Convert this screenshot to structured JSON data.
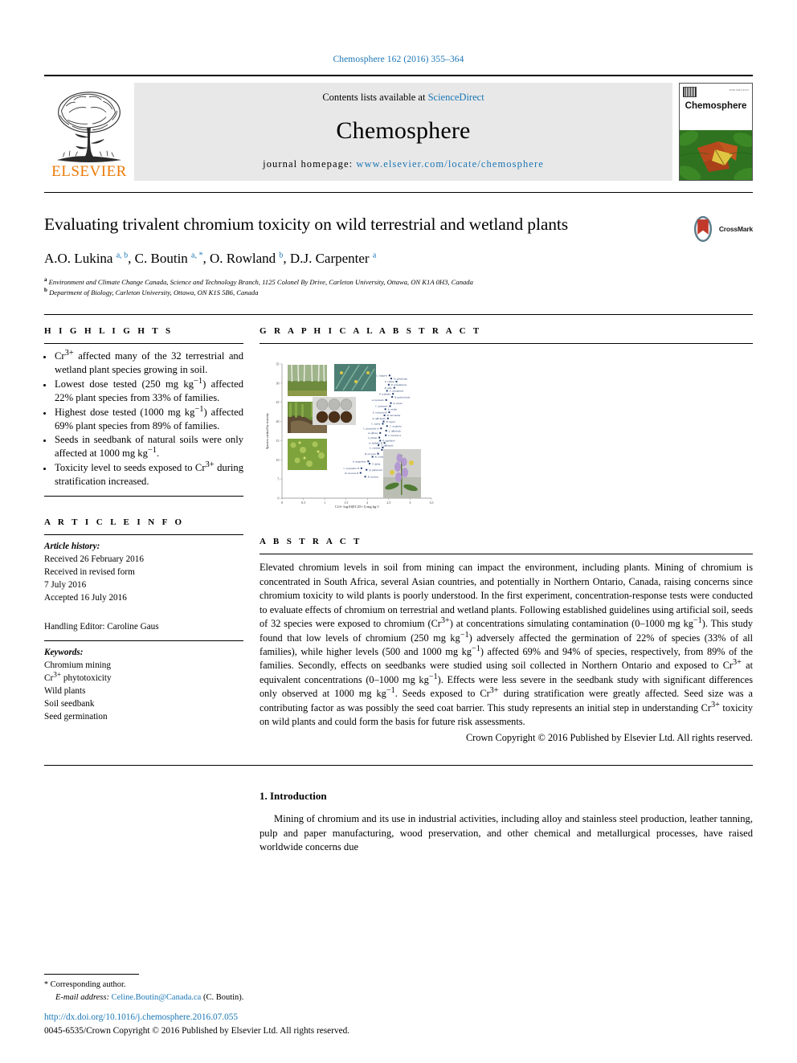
{
  "running_head": "Chemosphere 162 (2016) 355–364",
  "masthead": {
    "contents_prefix": "Contents lists available at ",
    "sciencedirect": "ScienceDirect",
    "journal_name": "Chemosphere",
    "homepage_prefix": "journal homepage: ",
    "homepage_url": "www.elsevier.com/locate/chemosphere",
    "publisher_logo_text": "ELSEVIER",
    "cover_title": "Chemosphere",
    "accent_blue": "#1a76b5",
    "elsevier_orange": "#ec7a08"
  },
  "article": {
    "title": "Evaluating trivalent chromium toxicity on wild terrestrial and wetland plants",
    "authors_html": "A.O. Lukina <sup>a, b</sup>, C. Boutin <sup>a, *</sup>, O. Rowland <sup>b</sup>, D.J. Carpenter <sup>a</sup>",
    "affiliation_a": "Environment and Climate Change Canada, Science and Technology Branch, 1125 Colonel By Drive, Carleton University, Ottawa, ON K1A 0H3, Canada",
    "affiliation_b": "Department of Biology, Carleton University, Ottawa, ON K1S 5B6, Canada",
    "crossmark_label": "CrossMark"
  },
  "highlights": {
    "heading": "H I G H L I G H T S",
    "items": [
      "Cr<sup>3+</sup> affected many of the 32 terrestrial and wetland plant species growing in soil.",
      "Lowest dose tested (250 mg kg<sup>−1</sup>) affected 22% plant species from 33% of families.",
      "Highest dose tested (1000 mg kg<sup>−1</sup>) affected 69% plant species from 89% of families.",
      "Seeds in seedbank of natural soils were only affected at 1000 mg kg<sup>−1</sup>.",
      "Toxicity level to seeds exposed to Cr<sup>3+</sup> during stratification increased."
    ]
  },
  "article_info": {
    "heading": "A R T I C L E   I N F O",
    "history_label": "Article history:",
    "received": "Received 26 February 2016",
    "revised_label": "Received in revised form",
    "revised_date": "7 July 2016",
    "accepted": "Accepted 16 July 2016",
    "handling_editor": "Handling Editor: Caroline Gaus",
    "keywords_label": "Keywords:",
    "keywords": [
      "Chromium mining",
      "Cr<sup>3+</sup> phytotoxicity",
      "Wild plants",
      "Soil seedbank",
      "Seed germination"
    ]
  },
  "graphical_abstract": {
    "heading": "G R A P H I C A L   A B S T R A C T"
  },
  "abstract": {
    "heading": "A B S T R A C T",
    "body": "Elevated chromium levels in soil from mining can impact the environment, including plants. Mining of chromium is concentrated in South Africa, several Asian countries, and potentially in Northern Ontario, Canada, raising concerns since chromium toxicity to wild plants is poorly understood. In the first experiment, concentration-response tests were conducted to evaluate effects of chromium on terrestrial and wetland plants. Following established guidelines using artificial soil, seeds of 32 species were exposed to chromium (Cr<sup>3+</sup>) at concentrations simulating contamination (0–1000 mg kg<sup>−1</sup>). This study found that low levels of chromium (250 mg kg<sup>−1</sup>) adversely affected the germination of 22% of species (33% of all families), while higher levels (500 and 1000 mg kg<sup>−1</sup>) affected 69% and 94% of species, respectively, from 89% of the families. Secondly, effects on seedbanks were studied using soil collected in Northern Ontario and exposed to Cr<sup>3+</sup> at equivalent concentrations (0–1000 mg kg<sup>−1</sup>). Effects were less severe in the seedbank study with significant differences only observed at 1000 mg kg<sup>−1</sup>. Seeds exposed to Cr<sup>3+</sup> during stratification were greatly affected. Seed size was a contributing factor as was possibly the seed coat barrier. This study represents an initial step in understanding Cr<sup>3+</sup> toxicity on wild plants and could form the basis for future risk assessments.",
    "copyright": "Crown Copyright © 2016 Published by Elsevier Ltd. All rights reserved."
  },
  "introduction": {
    "heading": "1. Introduction",
    "paragraph": "Mining of chromium and its use in industrial activities, including alloy and stainless steel production, leather tanning, pulp and paper manufacturing, wood preservation, and other chemical and metallurgical processes, have raised worldwide concerns due"
  },
  "footnote": {
    "star": "*",
    "corresponding": "Corresponding author.",
    "email_label": "E-mail address:",
    "email": "Celine.Boutin@Canada.ca",
    "email_owner": "(C. Boutin)."
  },
  "imprint": {
    "doi": "http://dx.doi.org/10.1016/j.chemosphere.2016.07.055",
    "issn_line": "0045-6535/Crown Copyright © 2016 Published by Elsevier Ltd. All rights reserved."
  },
  "chart_data": {
    "type": "scatter",
    "title": "",
    "xlabel": "Cr3+ log10(EC25+1) mg kg-1",
    "ylabel": "Species ranked by toxicity",
    "xlim": [
      0,
      3.5
    ],
    "ylim": [
      0,
      35
    ],
    "xticks": [
      "0",
      "0.5",
      "1",
      "1.5",
      "2",
      "2.5",
      "3",
      "3.5"
    ],
    "yticks": [
      "0",
      "5",
      "10",
      "15",
      "20",
      "25",
      "30",
      "35"
    ],
    "grid": false,
    "legend": "none",
    "points": [
      {
        "label": "L. vulgaris",
        "x": 2.52,
        "y": 32.0
      },
      {
        "label": "D. glomerata",
        "x": 2.56,
        "y": 31.2
      },
      {
        "label": "E. ciliata",
        "x": 2.68,
        "y": 30.4
      },
      {
        "label": "P. arundinacea",
        "x": 2.5,
        "y": 29.6
      },
      {
        "label": "B. alba",
        "x": 2.63,
        "y": 28.8
      },
      {
        "label": "E. canadensis",
        "x": 2.46,
        "y": 28.0
      },
      {
        "label": "P. sedoides",
        "x": 2.6,
        "y": 27.2
      },
      {
        "label": "B. galericulata",
        "x": 2.58,
        "y": 26.4
      },
      {
        "label": "A. hyemalis",
        "x": 2.44,
        "y": 25.6
      },
      {
        "label": "A. tenuis",
        "x": 2.55,
        "y": 24.8
      },
      {
        "label": "C. pratensis",
        "x": 2.53,
        "y": 24.0
      },
      {
        "label": "A. viridis",
        "x": 2.42,
        "y": 23.2
      },
      {
        "label": "E. urticaria B",
        "x": 2.51,
        "y": 22.4
      },
      {
        "label": "B. micrantha",
        "x": 2.4,
        "y": 21.6
      },
      {
        "label": "A. officinalis",
        "x": 2.48,
        "y": 20.8
      },
      {
        "label": "B. rigens",
        "x": 2.38,
        "y": 20.0
      },
      {
        "label": "C. sativa",
        "x": 2.36,
        "y": 19.4
      },
      {
        "label": "C. scoparia",
        "x": 2.46,
        "y": 18.8
      },
      {
        "label": "C. praealtior A",
        "x": 2.32,
        "y": 18.2
      },
      {
        "label": "S. officinale",
        "x": 2.44,
        "y": 17.6
      },
      {
        "label": "A. effusus",
        "x": 2.3,
        "y": 17.0
      },
      {
        "label": "L. inermis A",
        "x": 2.43,
        "y": 16.4
      },
      {
        "label": "S. pilosa",
        "x": 2.28,
        "y": 15.8
      },
      {
        "label": "P. capillaris",
        "x": 2.3,
        "y": 15.0
      },
      {
        "label": "A. latifolia B",
        "x": 2.4,
        "y": 14.4
      },
      {
        "label": "T. officinale",
        "x": 2.26,
        "y": 13.8
      },
      {
        "label": "L. cuneata",
        "x": 2.36,
        "y": 13.2
      },
      {
        "label": "C. urticaria A",
        "x": 2.34,
        "y": 12.6
      },
      {
        "label": "B. nervosa",
        "x": 2.25,
        "y": 11.6
      },
      {
        "label": "R. crispus",
        "x": 2.12,
        "y": 10.8
      },
      {
        "label": "A. sanguinea",
        "x": 2.02,
        "y": 9.6
      },
      {
        "label": "T. dubia",
        "x": 2.05,
        "y": 9.0
      },
      {
        "label": "C. praealtior B",
        "x": 1.86,
        "y": 7.8
      },
      {
        "label": "Q. pubescens B",
        "x": 1.98,
        "y": 7.4
      },
      {
        "label": "B. nervosa B",
        "x": 1.84,
        "y": 6.6
      },
      {
        "label": "R. acetosa",
        "x": 1.95,
        "y": 5.6
      }
    ]
  }
}
